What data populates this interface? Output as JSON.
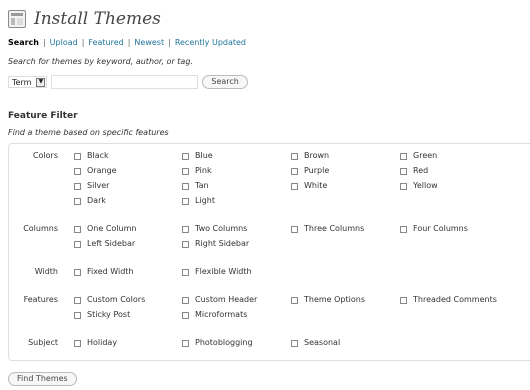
{
  "header": {
    "title": "Install Themes",
    "icon": "appearance-icon"
  },
  "tabs": [
    {
      "label": "Search",
      "current": true
    },
    {
      "label": "Upload"
    },
    {
      "label": "Featured"
    },
    {
      "label": "Newest"
    },
    {
      "label": "Recently Updated"
    }
  ],
  "tab_separator": "|",
  "search": {
    "description": "Search for themes by keyword, author, or tag.",
    "type_selected": "Term",
    "input_value": "",
    "button_label": "Search"
  },
  "feature_filter": {
    "heading": "Feature Filter",
    "description": "Find a theme based on specific features",
    "groups": [
      {
        "label": "Colors",
        "options": [
          "Black",
          "Blue",
          "Brown",
          "Green",
          "Orange",
          "Pink",
          "Purple",
          "Red",
          "Silver",
          "Tan",
          "White",
          "Yellow",
          "Dark",
          "Light"
        ]
      },
      {
        "label": "Columns",
        "options": [
          "One Column",
          "Two Columns",
          "Three Columns",
          "Four Columns",
          "Left Sidebar",
          "Right Sidebar"
        ]
      },
      {
        "label": "Width",
        "options": [
          "Fixed Width",
          "Flexible Width"
        ]
      },
      {
        "label": "Features",
        "options": [
          "Custom Colors",
          "Custom Header",
          "Theme Options",
          "Threaded Comments",
          "Sticky Post",
          "Microformats"
        ]
      },
      {
        "label": "Subject",
        "options": [
          "Holiday",
          "Photoblogging",
          "Seasonal"
        ]
      }
    ]
  },
  "find_button_label": "Find Themes",
  "colors": {
    "link": "#21759b",
    "border": "#dfdfdf",
    "text": "#333333"
  }
}
